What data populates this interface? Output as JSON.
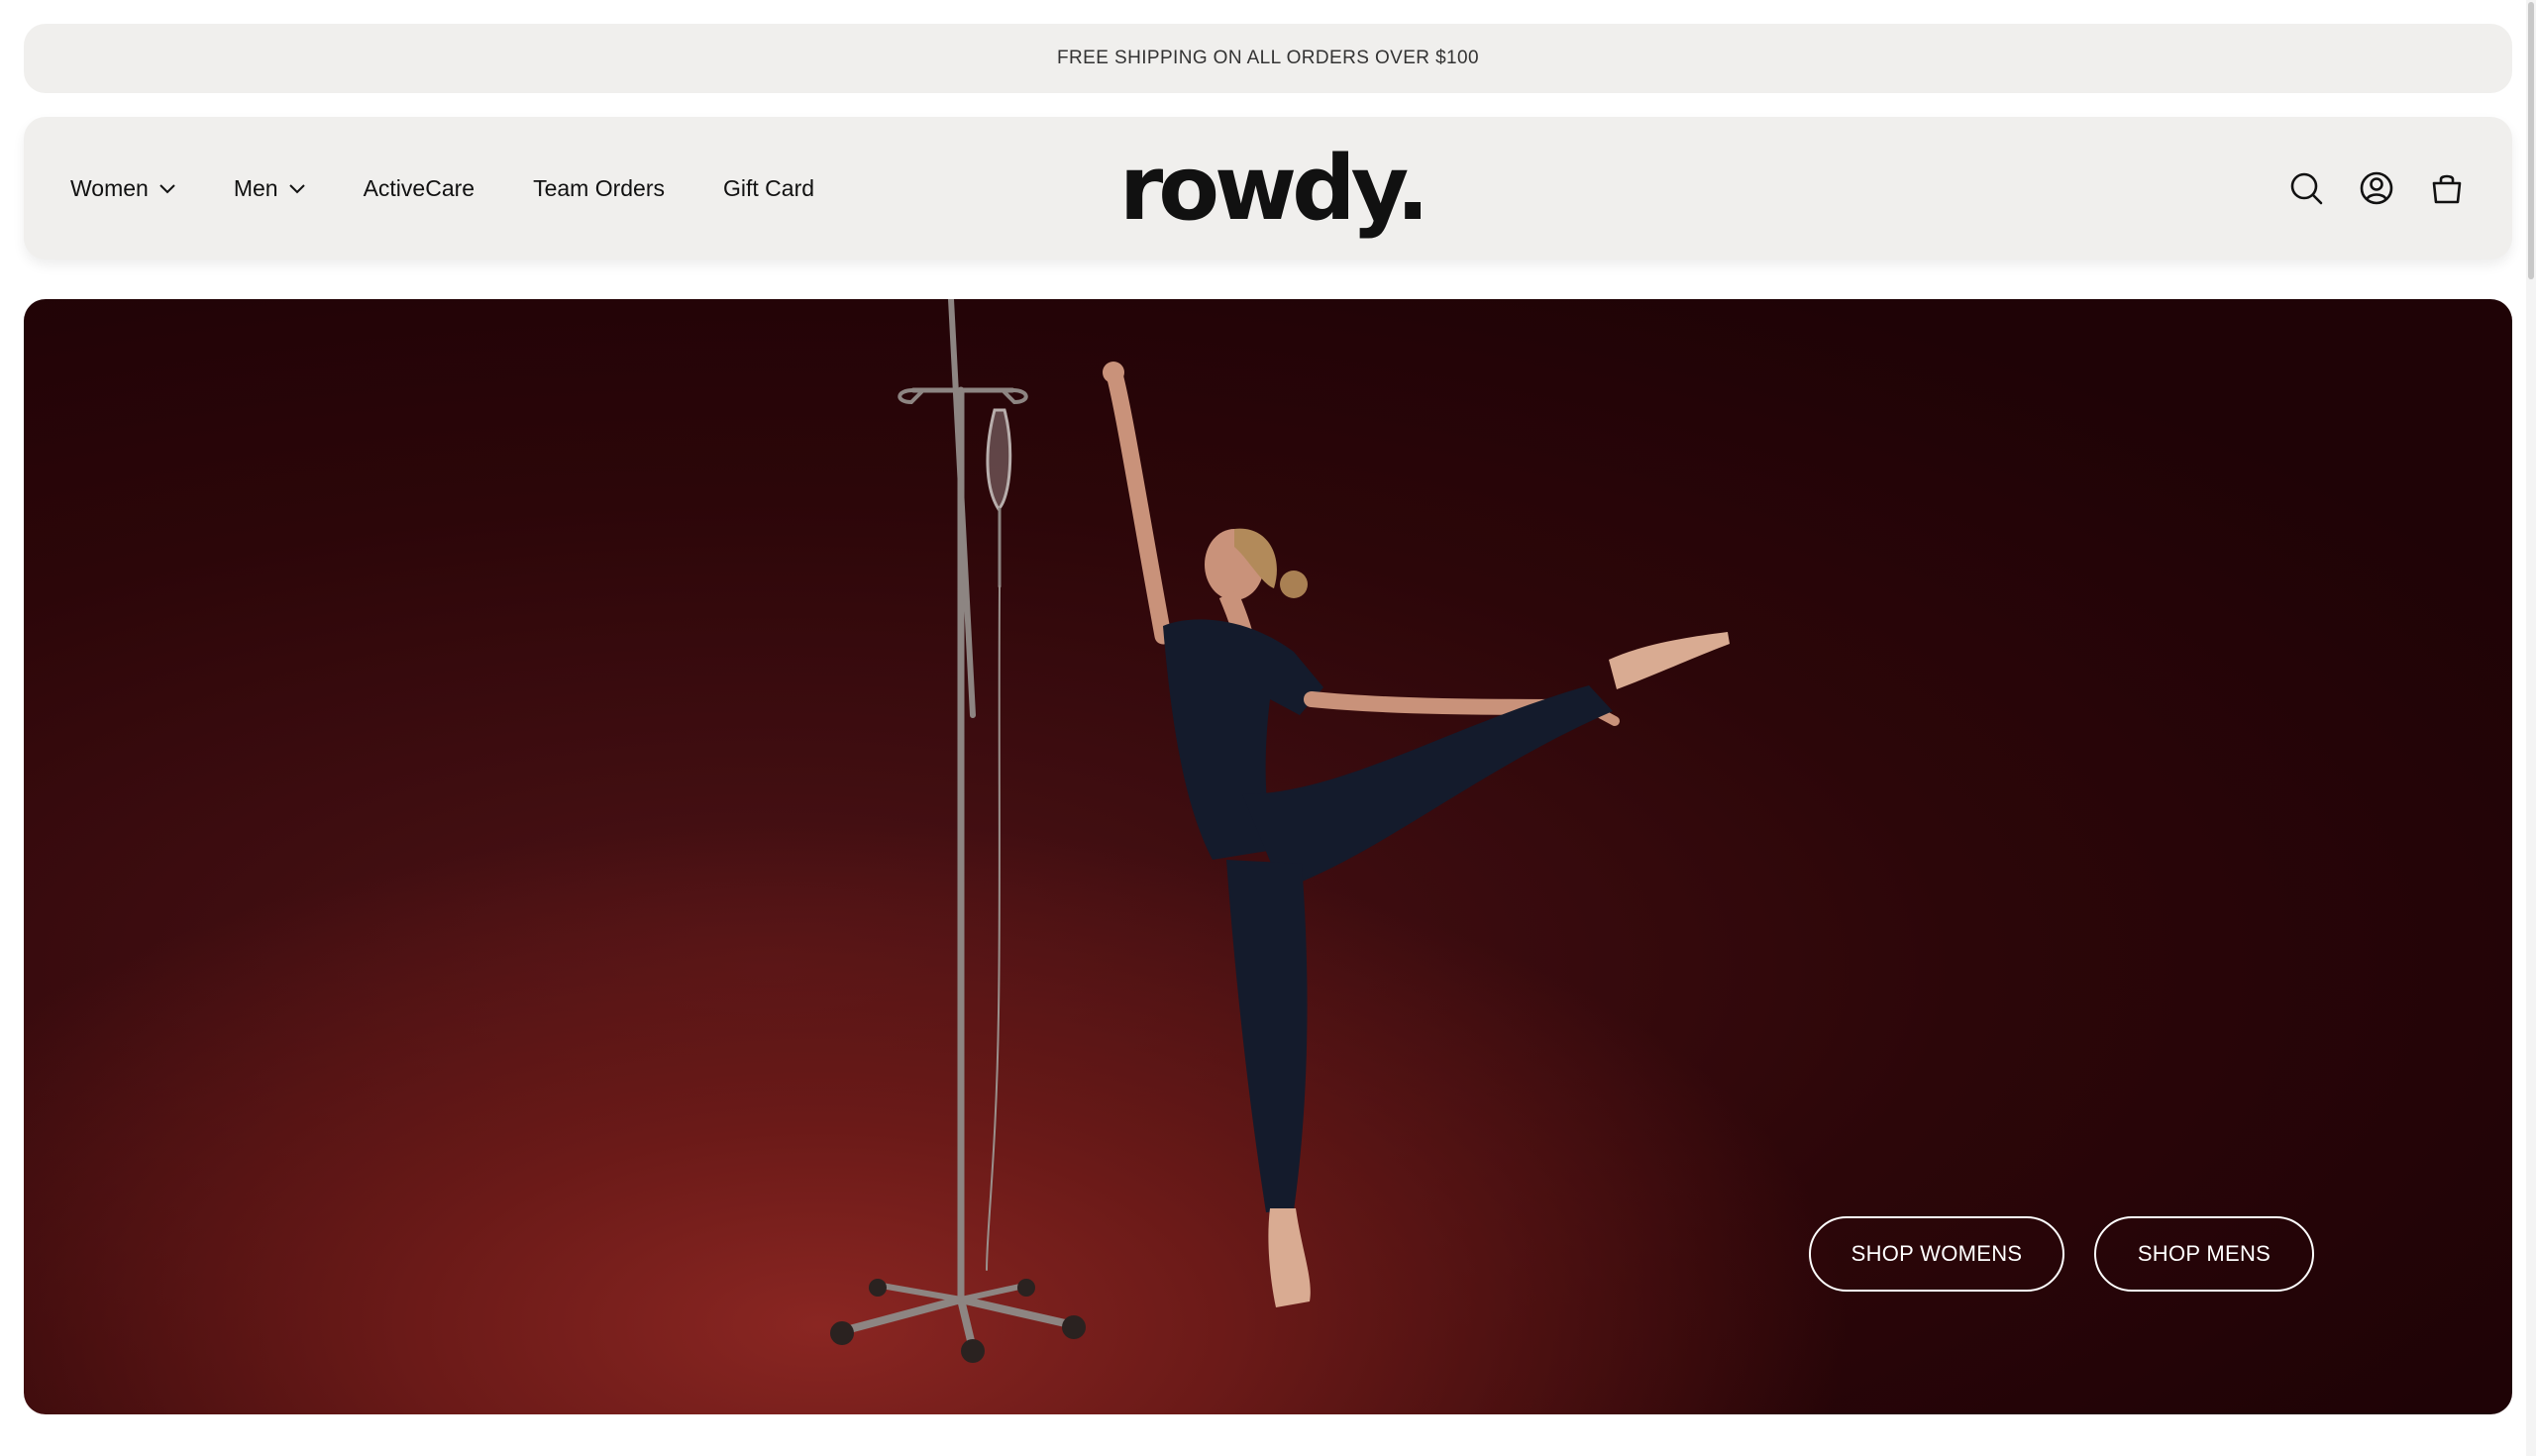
{
  "announcement": {
    "text": "FREE SHIPPING ON ALL ORDERS OVER $100"
  },
  "header": {
    "nav": [
      {
        "label": "Women",
        "has_dropdown": true
      },
      {
        "label": "Men",
        "has_dropdown": true
      },
      {
        "label": "ActiveCare",
        "has_dropdown": false
      },
      {
        "label": "Team Orders",
        "has_dropdown": false
      },
      {
        "label": "Gift Card",
        "has_dropdown": false
      }
    ],
    "logo": "rowdy.",
    "icons": [
      "search-icon",
      "account-icon",
      "cart-icon"
    ]
  },
  "hero": {
    "image": "ballerina in navy scrubs en pointe beside an IV pole on a deep red backdrop",
    "buttons": {
      "shop_womens": "SHOP WOMENS",
      "shop_mens": "SHOP MENS"
    }
  },
  "colors": {
    "bar_bg": "#f0efed",
    "hero_red": "#6b1a18",
    "hero_dark": "#1f0306",
    "scrubs_navy": "#141b2c",
    "text": "#111111",
    "button_text": "#ffffff"
  }
}
